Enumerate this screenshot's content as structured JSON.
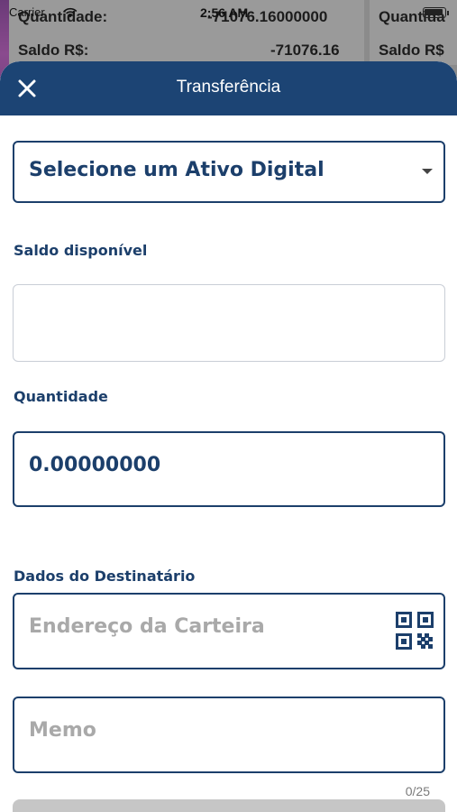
{
  "status_bar": {
    "carrier": "Carrier",
    "time": "2:56 AM"
  },
  "background": {
    "row1_label": "Quantidade:",
    "row1_value": "-71076.16000000",
    "row2_label": "Saldo R$:",
    "row2_value": "-71076.16",
    "right_row1_label": "Quantida",
    "right_row2_label": "Saldo R$"
  },
  "header": {
    "title": "Transferência"
  },
  "form": {
    "asset_select_value": "Selecione um Ativo Digital",
    "balance_label": "Saldo disponível",
    "balance_value": "",
    "quantity_label": "Quantidade",
    "quantity_value": "0.00000000",
    "recipient_label": "Dados do Destinatário",
    "wallet_placeholder": "Endereço da Carteira",
    "memo_placeholder": "Memo",
    "memo_counter": "0/25"
  },
  "colors": {
    "primary": "#1c4474",
    "label": "#1c3f6b",
    "placeholder": "#a9a9a9",
    "button_disabled": "#c6c6c6"
  },
  "icons": {
    "close": "close-icon",
    "caret": "chevron-down-icon",
    "qr": "qr-code-icon",
    "wifi": "wifi-icon",
    "battery": "battery-icon"
  }
}
